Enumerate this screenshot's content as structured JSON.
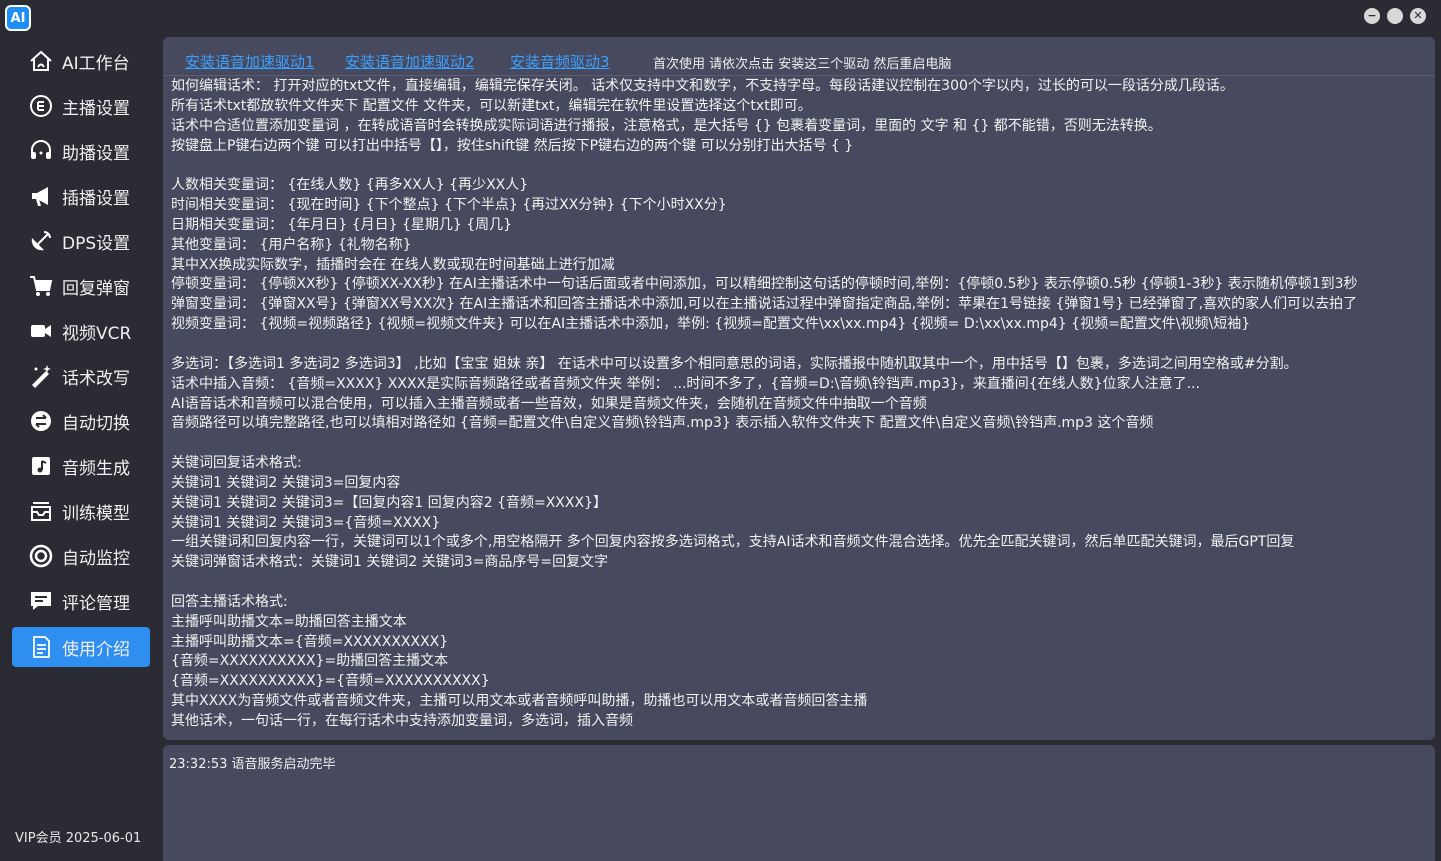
{
  "app": {
    "logo_text": "AI"
  },
  "window_controls": {
    "minimize": "−",
    "maximize": "",
    "close": "✕"
  },
  "sidebar": {
    "items": [
      {
        "label": "AI工作台",
        "icon": "home-icon"
      },
      {
        "label": "主播设置",
        "icon": "anchor-coin-icon"
      },
      {
        "label": "助播设置",
        "icon": "headset-icon"
      },
      {
        "label": "插播设置",
        "icon": "megaphone-icon"
      },
      {
        "label": "DPS设置",
        "icon": "satellite-dish-icon"
      },
      {
        "label": "回复弹窗",
        "icon": "cart-icon"
      },
      {
        "label": "视频VCR",
        "icon": "video-camera-icon"
      },
      {
        "label": "话术改写",
        "icon": "magic-pen-icon"
      },
      {
        "label": "自动切换",
        "icon": "switch-icon"
      },
      {
        "label": "音频生成",
        "icon": "music-note-icon"
      },
      {
        "label": "训练模型",
        "icon": "inbox-icon"
      },
      {
        "label": "自动监控",
        "icon": "monitor-lens-icon"
      },
      {
        "label": "评论管理",
        "icon": "comment-icon"
      },
      {
        "label": "使用介绍",
        "icon": "document-icon",
        "active": true
      }
    ],
    "vip": "VIP会员  2025-06-01"
  },
  "colors": {
    "accent": "#2f8ff0",
    "panel": "#474a5e",
    "background": "#2b2c33",
    "link": "#3aa0ff"
  },
  "toolbar": {
    "links": [
      "安装语音加速驱动1",
      "安装语音加速驱动2",
      "安装音频驱动3"
    ],
    "note": "首次使用 请依次点击 安装这三个驱动 然后重启电脑"
  },
  "help_lines": [
    "如何编辑话术：      打开对应的txt文件，直接编辑，编辑完保存关闭。  话术仅支持中文和数字，不支持字母。每段话建议控制在300个字以内，过长的可以一段话分成几段话。",
    "所有话术txt都放软件文件夹下  配置文件  文件夹，可以新建txt，编辑完在软件里设置选择这个txt即可。",
    "话术中合适位置添加变量词 ，在转成语音时会转换成实际词语进行播报，注意格式，是大括号 {} 包裹着变量词，里面的 文字 和 {} 都不能错，否则无法转换。",
    "按键盘上P键右边两个键  可以打出中括号【】，按住shift键 然后按下P键右边的两个键 可以分别打出大括号 { }",
    "",
    "人数相关变量词：   {在线人数}  {再多XX人}  {再少XX人}",
    "时间相关变量词：   {现在时间}  {下个整点}  {下个半点}  {再过XX分钟}  {下个小时XX分}",
    "日期相关变量词：   {年月日} {月日} {星期几} {周几}",
    "其他变量词：          {用户名称}  {礼物名称}",
    "其中XX换成实际数字，插播时会在 在线人数或现在时间基础上进行加减",
    "停顿变量词：   {停顿XX秒} {停顿XX-XX秒} 在AI主播话术中一句话后面或者中间添加，可以精细控制这句话的停顿时间,举例：{停顿0.5秒}  表示停顿0.5秒  {停顿1-3秒}  表示随机停顿1到3秒",
    "弹窗变量词：   {弹窗XX号} {弹窗XX号XX次} 在AI主播话术和回答主播话术中添加,可以在主播说话过程中弹窗指定商品,举例：苹果在1号链接  {弹窗1号}  已经弹窗了,喜欢的家人们可以去拍了",
    "视频变量词：   {视频=视频路径}   {视频=视频文件夹}  可以在AI主播话术中添加，举例: {视频=配置文件\\xx\\xx.mp4}  {视频= D:\\xx\\xx.mp4}  {视频=配置文件\\视频\\短袖}",
    "",
    "多选词：【多选词1  多选词2  多选词3】 ,比如【宝宝  姐妹  亲】 在话术中可以设置多个相同意思的词语，实际播报中随机取其中一个，用中括号【】包裹，多选词之间用空格或#分割。",
    "话术中插入音频：   {音频=XXXX} XXXX是实际音频路径或者音频文件夹  举例：   ...时间不多了，{音频=D:\\音频\\铃铛声.mp3}，来直播间{在线人数}位家人注意了...",
    "AI语音话术和音频可以混合使用，可以插入主播音频或者一些音效，如果是音频文件夹，会随机在音频文件中抽取一个音频",
    "音频路径可以填完整路径,也可以填相对路径如  {音频=配置文件\\自定义音频\\铃铛声.mp3} 表示插入软件文件夹下  配置文件\\自定义音频\\铃铛声.mp3 这个音频",
    "",
    "关键词回复话术格式:",
    "关键词1 关键词2 关键词3=回复内容",
    "关键词1  关键词2  关键词3=【回复内容1  回复内容2  {音频=XXXX}】",
    "关键词1  关键词2  关键词3={音频=XXXX}",
    "一组关键词和回复内容一行，关键词可以1个或多个,用空格隔开  多个回复内容按多选词格式，支持AI话术和音频文件混合选择。优先全匹配关键词，然后单匹配关键词，最后GPT回复",
    "关键词弹窗话术格式：关键词1 关键词2 关键词3=商品序号=回复文字",
    "",
    "回答主播话术格式:",
    "主播呼叫助播文本=助播回答主播文本",
    "主播呼叫助播文本={音频=XXXXXXXXXX}",
    "{音频=XXXXXXXXXX}=助播回答主播文本",
    "{音频=XXXXXXXXXX}={音频=XXXXXXXXXX}",
    "其中XXXX为音频文件或者音频文件夹，主播可以用文本或者音频呼叫助播，助播也可以用文本或者音频回答主播",
    "其他话术，一句话一行，在每行话术中支持添加变量词，多选词，插入音频"
  ],
  "log": {
    "line": "23:32:53 语音服务启动完毕"
  }
}
